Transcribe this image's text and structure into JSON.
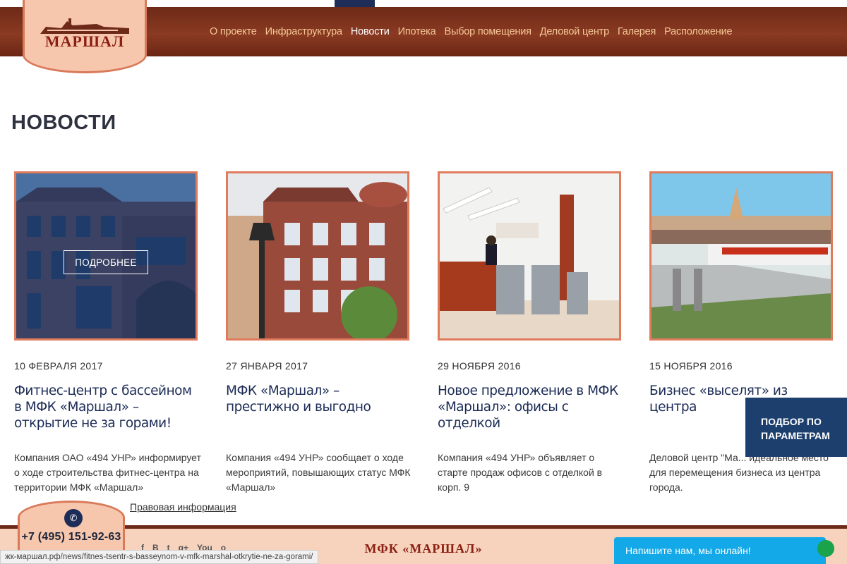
{
  "header": {
    "logo_text": "МАРШАЛ",
    "nav": [
      {
        "label": "О проекте",
        "active": false
      },
      {
        "label": "Инфраструктура",
        "active": false
      },
      {
        "label": "Новости",
        "active": true
      },
      {
        "label": "Ипотека",
        "active": false
      },
      {
        "label": "Выбор помещения",
        "active": false
      },
      {
        "label": "Деловой центр",
        "active": false
      },
      {
        "label": "Галерея",
        "active": false
      },
      {
        "label": "Расположение",
        "active": false
      }
    ]
  },
  "page_title": "НОВОСТИ",
  "news": [
    {
      "date": "10 ФЕВРАЛЯ 2017",
      "title": "Фитнес-центр с бассейном в МФК «Маршал» – открытие не за горами!",
      "excerpt": "Компания ОАО «494 УНР» информирует о ходе строительства фитнес-центра на территории МФК «Маршал»",
      "more_label": "ПОДРОБНЕЕ"
    },
    {
      "date": "27 ЯНВАРЯ 2017",
      "title": "МФК «Маршал» – престижно и выгодно",
      "excerpt": "Компания «494 УНР» сообщает о ходе мероприятий, повышающих статус МФК «Маршал»"
    },
    {
      "date": "29 НОЯБРЯ 2016",
      "title": "Новое предложение в МФК «Маршал»: офисы с отделкой",
      "excerpt": "Компания «494 УНР» объявляет о старте продаж офисов с отделкой в корп. 9"
    },
    {
      "date": "15 НОЯБРЯ 2016",
      "title": "Бизнес «выселят» из центра",
      "excerpt": "Деловой центр \"Ма... идеальное место для перемещения бизнеса из центра города."
    }
  ],
  "filter_tab": {
    "line1": "ПОДБОР ПО",
    "line2": "ПАРАМЕТРАМ"
  },
  "legal_link": "Правовая информация",
  "phone": "+7 (495) 151-92-63",
  "footer": {
    "brand": "МФК «МАРШАЛ»",
    "socials": [
      "f",
      "В",
      "t",
      "g+",
      "You",
      "о"
    ]
  },
  "status_url": "жк-маршал.рф/news/fitnes-tsentr-s-basseynom-v-mfk-marshal-otkrytie-ne-za-gorami/",
  "chat_label": "Напишите нам, мы онлайн!",
  "colors": {
    "header": "#7a3019",
    "accent": "#e07b5c",
    "navy": "#1d3f6e",
    "chat": "#13a8e8"
  }
}
